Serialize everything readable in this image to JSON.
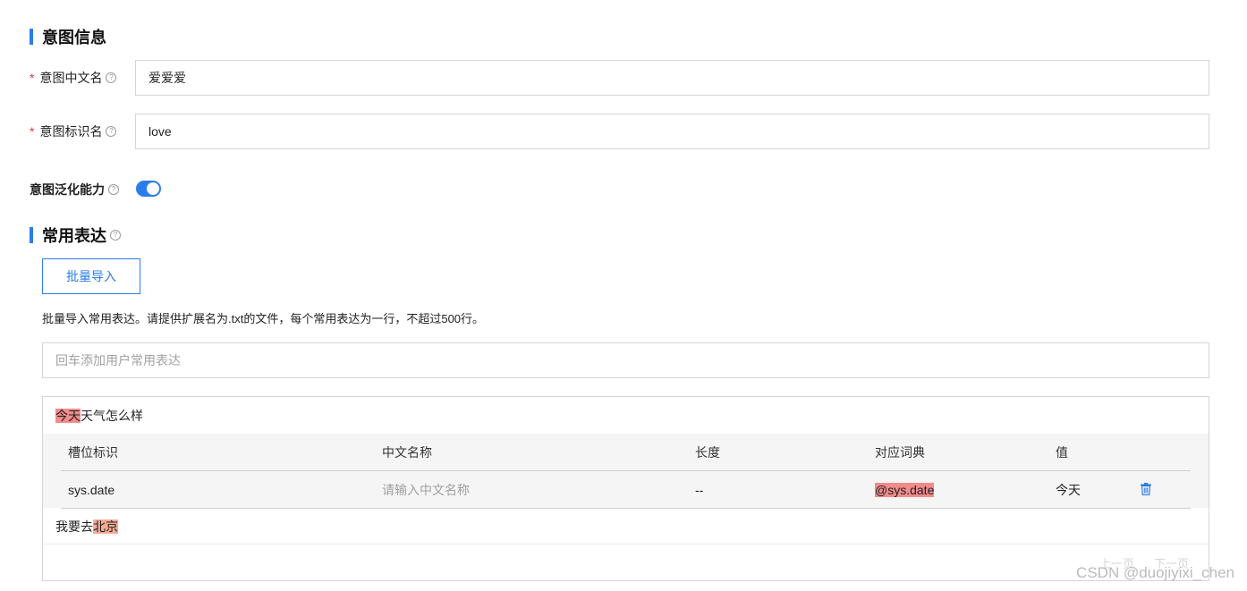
{
  "intent_section": {
    "title": "意图信息",
    "cn_name_label": "意图中文名",
    "cn_name_value": "爱爱爱",
    "id_name_label": "意图标识名",
    "id_name_value": "love",
    "generalize_label": "意图泛化能力",
    "generalize_enabled": true,
    "required_mark": "*",
    "help_glyph": "?"
  },
  "expressions_section": {
    "title": "常用表达",
    "import_button": "批量导入",
    "hint": "批量导入常用表达。请提供扩展名为.txt的文件，每个常用表达为一行，不超过500行。",
    "input_placeholder": "回车添加用户常用表达",
    "expr1": {
      "highlight": "今天",
      "rest": "天气怎么样"
    },
    "slot_table": {
      "headers": [
        "槽位标识",
        "中文名称",
        "长度",
        "对应词典",
        "值"
      ],
      "row": {
        "slot_id": "sys.date",
        "cn_name_placeholder": "请输入中文名称",
        "length": "--",
        "dictionary": "@sys.date",
        "value": "今天"
      }
    },
    "expr2": {
      "prefix": "我要去",
      "highlight": "北京"
    },
    "pager": {
      "prev": "上一页",
      "next": "下一页"
    }
  },
  "watermark": "CSDN @duojiyixi_chen",
  "colors": {
    "accent": "#2b7de9",
    "required": "#e0393e",
    "highlight_red": "#f28b8b",
    "highlight_orange": "#f5ab95"
  }
}
